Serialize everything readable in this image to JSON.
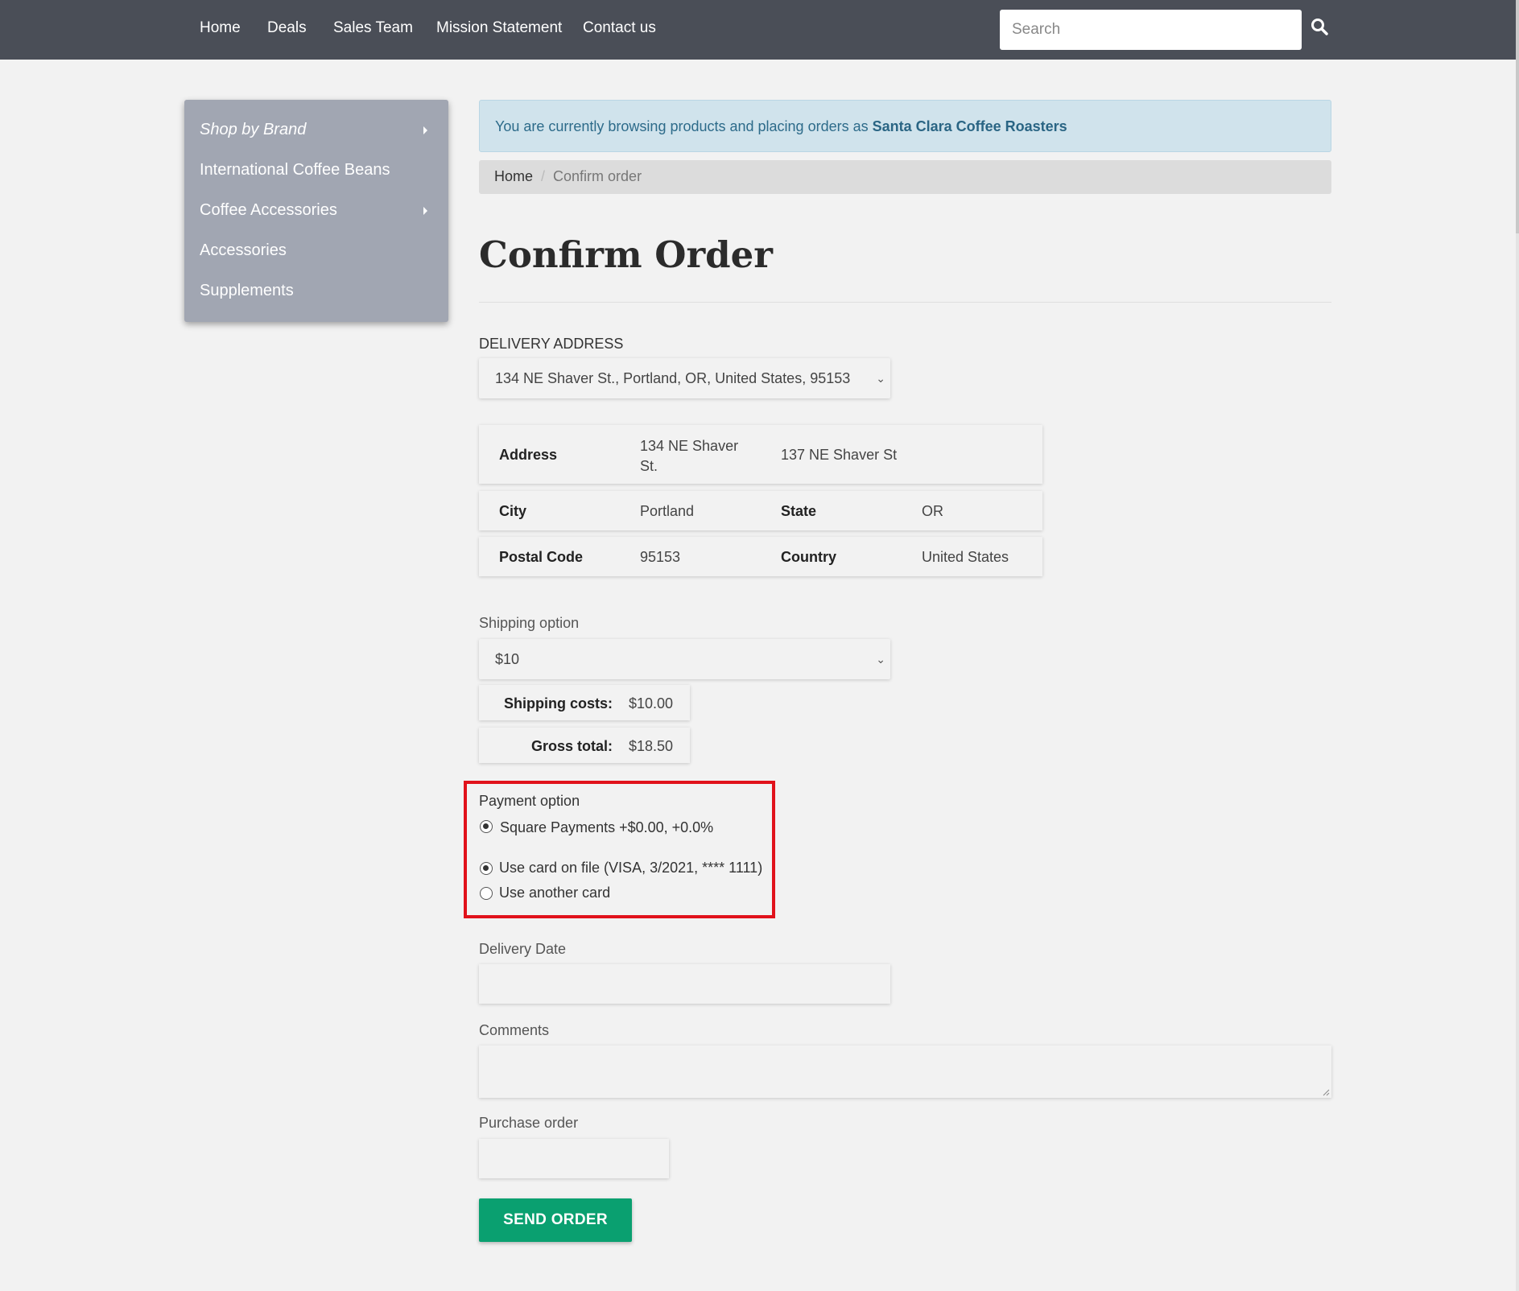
{
  "nav": {
    "links": [
      "Home",
      "Deals",
      "Sales Team",
      "Mission Statement",
      "Contact us"
    ],
    "search_placeholder": "Search"
  },
  "sidebar": {
    "items": [
      {
        "label": "Shop by Brand",
        "has_submenu": true
      },
      {
        "label": "International Coffee Beans",
        "has_submenu": false
      },
      {
        "label": "Coffee Accessories",
        "has_submenu": true
      },
      {
        "label": "Accessories",
        "has_submenu": false
      },
      {
        "label": "Supplements",
        "has_submenu": false
      }
    ]
  },
  "alert": {
    "text": "You are currently browsing products and placing orders as ",
    "company": "Santa Clara Coffee Roasters"
  },
  "breadcrumb": {
    "home": "Home",
    "separator": "/",
    "current": "Confirm order"
  },
  "page": {
    "title": "Confirm Order"
  },
  "delivery": {
    "label": "DELIVERY ADDRESS",
    "selected": "134 NE Shaver St., Portland, OR, United States, 95153",
    "address_label": "Address",
    "address_line1": "134 NE Shaver St.",
    "address_line2": "137 NE Shaver St",
    "city_label": "City",
    "city": "Portland",
    "state_label": "State",
    "state": "OR",
    "postal_label": "Postal Code",
    "postal": "95153",
    "country_label": "Country",
    "country": "United States"
  },
  "shipping": {
    "label": "Shipping option",
    "selected": "$10",
    "costs_label": "Shipping costs:",
    "costs_value": "$10.00",
    "gross_label": "Gross total:",
    "gross_value": "$18.50"
  },
  "payment": {
    "label": "Payment option",
    "options": [
      {
        "label": "Square Payments +$0.00, +0.0%",
        "checked": true
      },
      {
        "label": "Use card on file (VISA, 3/2021, **** 1111)",
        "checked": true
      },
      {
        "label": "Use another card",
        "checked": false
      }
    ]
  },
  "form": {
    "delivery_date_label": "Delivery Date",
    "comments_label": "Comments",
    "purchase_order_label": "Purchase order",
    "send_label": "SEND ORDER"
  },
  "colors": {
    "nav_bg": "#4a4e57",
    "sidebar_bg": "#a1a6b2",
    "alert_bg": "#d0e3ec",
    "send_button": "#0aa070",
    "highlight": "#e1121b"
  }
}
